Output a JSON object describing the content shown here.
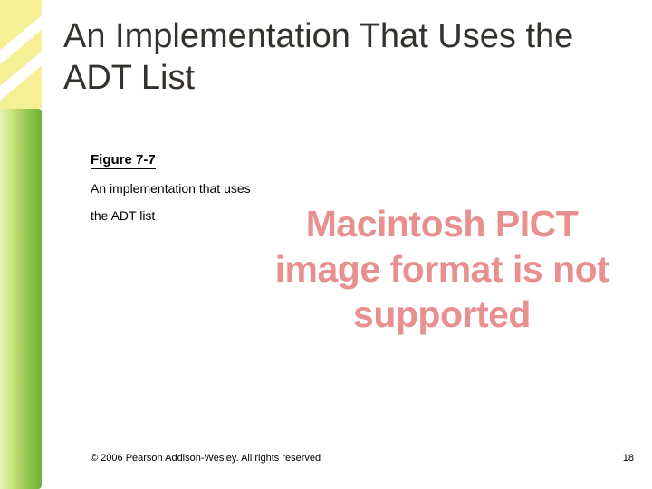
{
  "slide": {
    "title": "An Implementation That Uses the ADT List",
    "figure_label": "Figure 7-7",
    "caption_line1": "An implementation that uses",
    "caption_line2": "the ADT list",
    "image_error": "Macintosh PICT image format is not supported",
    "copyright": "© 2006 Pearson Addison-Wesley. All rights reserved",
    "page_number": "18"
  }
}
